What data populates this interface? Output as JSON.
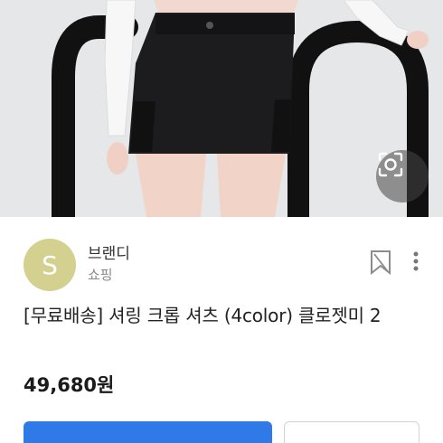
{
  "photo": {
    "description_icon": "visual-search-icon"
  },
  "seller": {
    "avatar_letter": "S",
    "name": "브랜디",
    "sub": "쇼핑",
    "avatar_color": "#d4d08f"
  },
  "product": {
    "title": "[무료배송] 셔링 크롭 셔츠 (4color) 클로젯미 2",
    "price": "49,680원"
  },
  "icons": {
    "bookmark": "bookmark-icon",
    "more": "more-vertical-icon"
  },
  "colors": {
    "primary": "#2f7ae6"
  }
}
